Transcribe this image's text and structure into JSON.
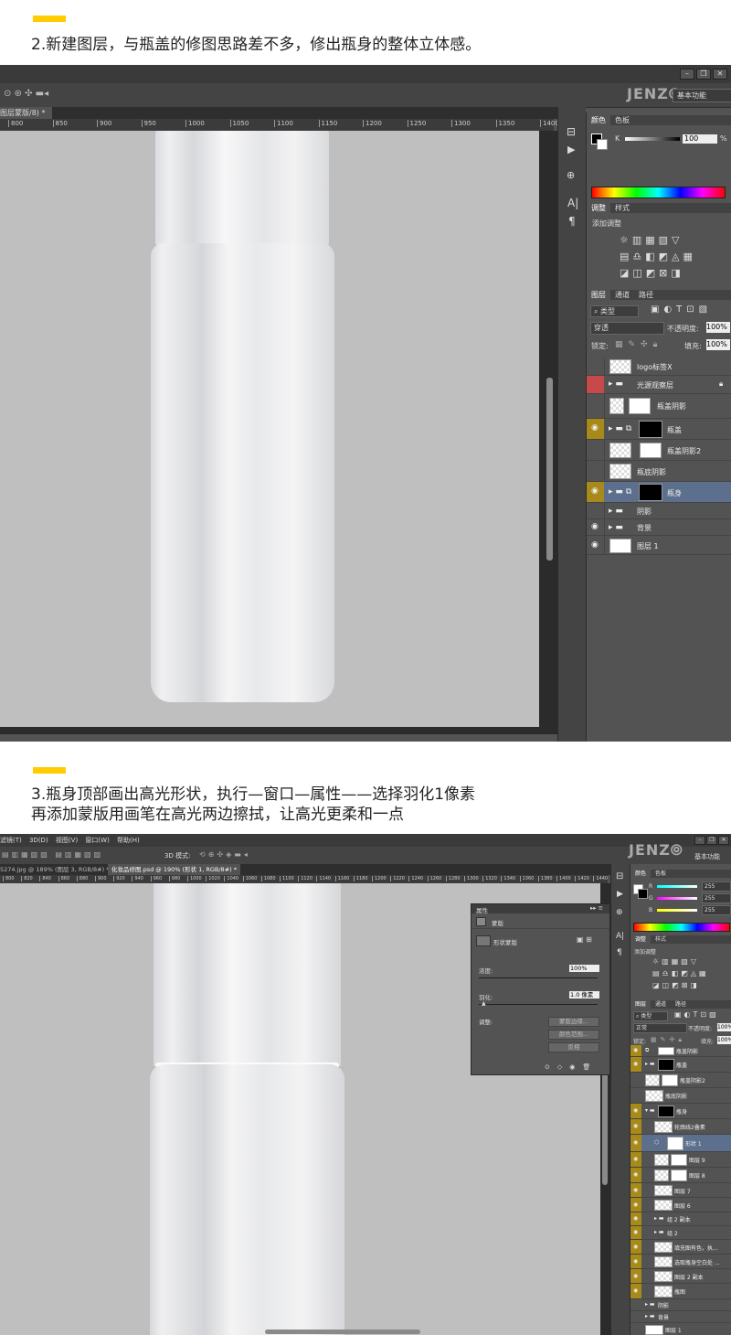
{
  "step2": {
    "title": "2.新建图层，与瓶盖的修图思路差不多，修出瓶身的整体立体感。",
    "doc_tab": "图层蒙版/8) *",
    "workspace": "基本功能",
    "ruler_ticks": [
      "800",
      "850",
      "900",
      "950",
      "1000",
      "1050",
      "1100",
      "1150",
      "1200",
      "1250",
      "1300",
      "1350",
      "1400"
    ],
    "color_tabs": [
      "颜色",
      "色板"
    ],
    "color_k_label": "K",
    "color_k_value": "100",
    "color_pct": "%",
    "adjust_tabs": [
      "调整",
      "样式"
    ],
    "add_adjust": "添加调整",
    "layer_tabs": [
      "图层",
      "通道",
      "路径"
    ],
    "kind_filter": "类型",
    "blend_mode": "穿透",
    "opacity_label": "不透明度:",
    "opacity_value": "100%",
    "lock_label": "锁定:",
    "fill_label": "填充:",
    "fill_value": "100%",
    "layers": [
      "logo标签X",
      "光源观察层",
      "瓶盖阴影",
      "瓶盖",
      "瓶盖阴影2",
      "瓶底阴影",
      "瓶身",
      "阴影",
      "背景",
      "图层 1"
    ]
  },
  "step3": {
    "title_line1": "3.瓶身顶部画出高光形状，执行—窗口—属性——选择羽化1像素",
    "title_line2": "再添加蒙版用画笔在高光两边擦拭，让高光更柔和一点",
    "menu": [
      "滤镜(T)",
      "3D(D)",
      "视图(V)",
      "窗口(W)",
      "帮助(H)"
    ],
    "mode_3d": "3D 模式:",
    "tab_a": "5274.jpg @ 189% (图层 3, RGB/8#) *",
    "tab_b": "化妆品修图.psd @ 190% (形状 1, RGB/8#) *",
    "workspace": "基本功能",
    "ruler_ticks": [
      "800",
      "820",
      "840",
      "860",
      "880",
      "900",
      "920",
      "940",
      "960",
      "980",
      "1000",
      "1020",
      "1040",
      "1060",
      "1080",
      "1100",
      "1120",
      "1140",
      "1160",
      "1180",
      "1200",
      "1220",
      "1240",
      "1260",
      "1280",
      "1300",
      "1320",
      "1340",
      "1360",
      "1380",
      "1400",
      "1420",
      "1440"
    ],
    "props": {
      "header": "属性",
      "section": "蒙版",
      "shape_mask": "形状蒙版",
      "density_label": "浓度:",
      "density_value": "100%",
      "feather_label": "羽化:",
      "feather_value": "1.0 像素",
      "refine_label": "调整:",
      "btn_mask_edge": "蒙版边缘...",
      "btn_color_range": "颜色范围...",
      "btn_invert": "反相"
    },
    "color_tabs": [
      "颜色",
      "色板"
    ],
    "rgb": [
      {
        "ch": "R",
        "v": "255"
      },
      {
        "ch": "G",
        "v": "255"
      },
      {
        "ch": "B",
        "v": "255"
      }
    ],
    "adjust_tabs": [
      "调整",
      "样式"
    ],
    "add_adjust": "添加调整",
    "layer_tabs": [
      "图层",
      "通道",
      "路径"
    ],
    "kind_filter": "类型",
    "blend_mode": "正常",
    "opacity_label": "不透明度:",
    "opacity_value": "100%",
    "lock_label": "锁定:",
    "fill_label": "填充:",
    "fill_value": "100%",
    "layers": [
      "瓶盖阴影",
      "瓶盖",
      "瓶盖阴影2",
      "瓶底阴影",
      "瓶身",
      "轮廓线2叠素",
      "形状 1",
      "图层 9",
      "图层 8",
      "图层 7",
      "图层 6",
      "组 2 副本",
      "组 2",
      "填充图有色，执...",
      "选取瓶身空白处 ...",
      "图层 2 副本",
      "瓶图",
      "阴影",
      "背景",
      "图层 1"
    ]
  }
}
